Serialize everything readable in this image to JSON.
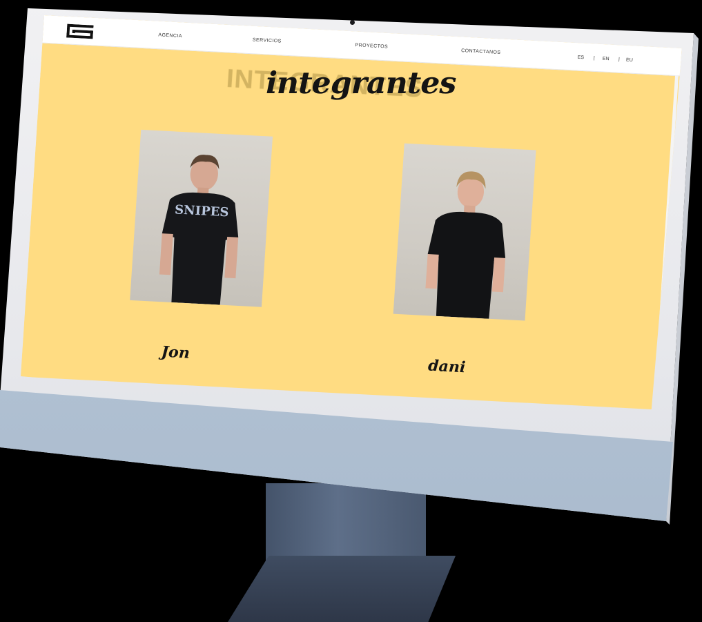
{
  "nav": {
    "links": [
      "AGENCIA",
      "SERVICIOS",
      "PROYECTOS",
      "CONTACTANOS"
    ],
    "languages": [
      "ES",
      "EN",
      "EU"
    ],
    "separator": "|"
  },
  "hero": {
    "ghost_title": "INTEGRANTES",
    "title": "integrantes"
  },
  "members": [
    {
      "name": "Jon",
      "shirt_text": "SNIPES"
    },
    {
      "name": "dani"
    }
  ],
  "colors": {
    "page_background": "#FFDC82",
    "navbar": "#ffffff",
    "text": "#141414",
    "chin": "#a8b9cc"
  }
}
